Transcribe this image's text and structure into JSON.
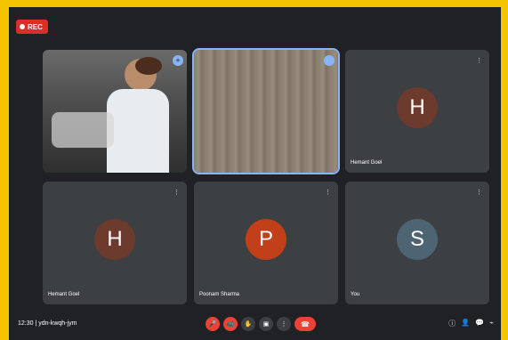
{
  "recording": {
    "label": "REC"
  },
  "tiles": [
    {
      "name": "",
      "type": "video-lab"
    },
    {
      "name": "",
      "type": "video-wall"
    },
    {
      "name": "Hemant Goel",
      "initial": "H",
      "color": "#6d3b2e"
    },
    {
      "name": "Hemant Goel",
      "initial": "H",
      "color": "#6d3b2e"
    },
    {
      "name": "Poonam Sharma",
      "initial": "P",
      "color": "#c1401a"
    },
    {
      "name": "You",
      "initial": "S",
      "color": "#4d6472"
    }
  ],
  "bar": {
    "meeting_info": "12:30 | ydn-kwqh-jym"
  }
}
